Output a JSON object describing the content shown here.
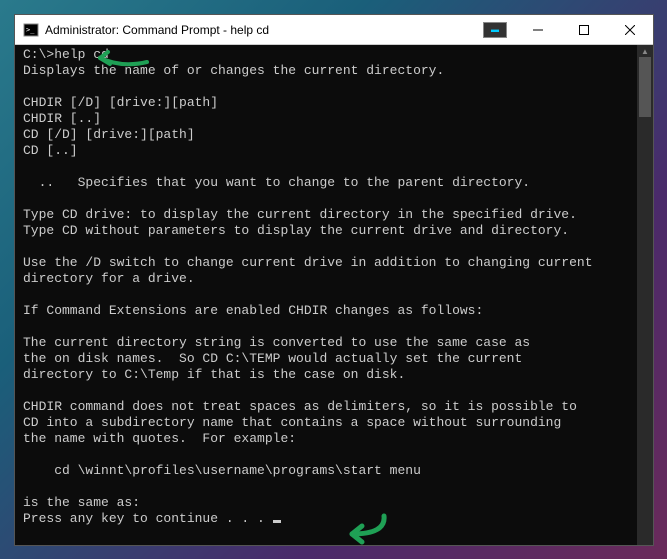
{
  "titlebar": {
    "title": "Administrator: Command Prompt - help  cd"
  },
  "terminal": {
    "prompt": "C:\\>",
    "command": "help cd",
    "lines": [
      "Displays the name of or changes the current directory.",
      "",
      "CHDIR [/D] [drive:][path]",
      "CHDIR [..]",
      "CD [/D] [drive:][path]",
      "CD [..]",
      "",
      "  ..   Specifies that you want to change to the parent directory.",
      "",
      "Type CD drive: to display the current directory in the specified drive.",
      "Type CD without parameters to display the current drive and directory.",
      "",
      "Use the /D switch to change current drive in addition to changing current",
      "directory for a drive.",
      "",
      "If Command Extensions are enabled CHDIR changes as follows:",
      "",
      "The current directory string is converted to use the same case as",
      "the on disk names.  So CD C:\\TEMP would actually set the current",
      "directory to C:\\Temp if that is the case on disk.",
      "",
      "CHDIR command does not treat spaces as delimiters, so it is possible to",
      "CD into a subdirectory name that contains a space without surrounding",
      "the name with quotes.  For example:",
      "",
      "    cd \\winnt\\profiles\\username\\programs\\start menu",
      "",
      "is the same as:"
    ],
    "continue_prompt": "Press any key to continue . . . "
  }
}
